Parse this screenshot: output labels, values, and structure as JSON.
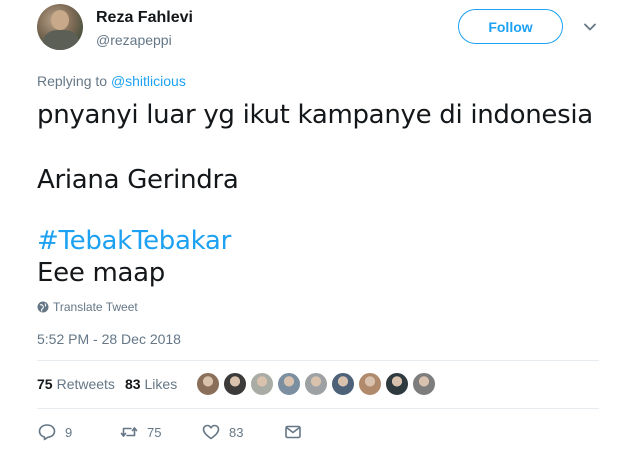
{
  "user": {
    "display_name": "Reza Fahlevi",
    "handle": "@rezapeppi"
  },
  "follow_label": "Follow",
  "reply": {
    "prefix": "Replying to ",
    "mention": "@shitlicious"
  },
  "tweet": {
    "line1": "pnyanyi luar yg ikut kampanye di indonesia",
    "line2": "Ariana Gerindra",
    "hashtag": "#TebakTebakar",
    "line4": "Eee maap"
  },
  "translate_label": "Translate Tweet",
  "timestamp": "5:52 PM - 28 Dec 2018",
  "stats": {
    "retweets_count": "75",
    "retweets_label": "Retweets",
    "likes_count": "83",
    "likes_label": "Likes"
  },
  "liker_faces": [
    "#8a6f5a",
    "#3d3a3a",
    "#a9aca5",
    "#7b8fa0",
    "#9ea1a4",
    "#4d6178",
    "#b08a6a",
    "#2f3a3f",
    "#7d7d7d"
  ],
  "actions": {
    "reply_count": "9",
    "retweet_count": "75",
    "like_count": "83"
  },
  "colors": {
    "accent": "#1da1f2",
    "secondary_text": "#657786",
    "primary_text": "#14171a"
  }
}
